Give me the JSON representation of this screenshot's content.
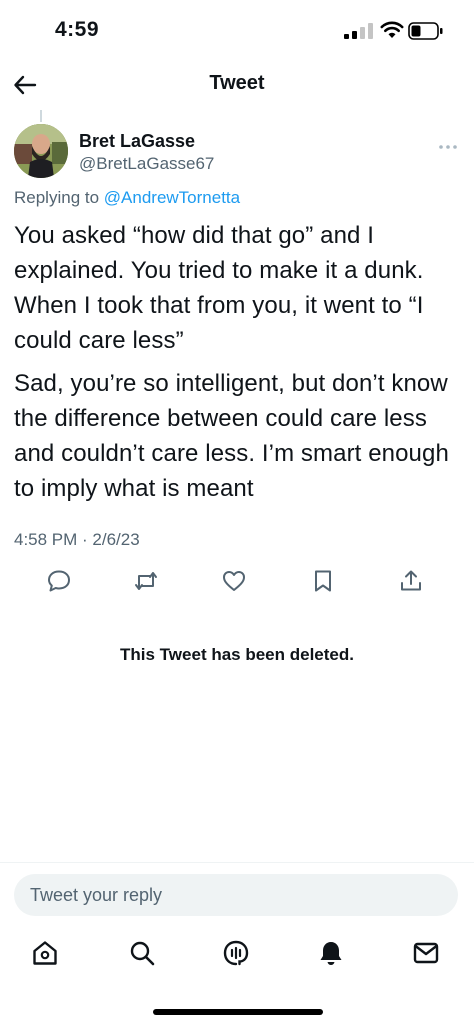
{
  "status_bar": {
    "time": "4:59"
  },
  "header": {
    "title": "Tweet",
    "back_icon": "arrow-left-icon"
  },
  "tweet": {
    "author_name": "Bret LaGasse",
    "author_handle": "@BretLaGasse67",
    "replying_prefix": "Replying to ",
    "replying_to": "@AndrewTornetta",
    "paragraphs": [
      "You asked “how did that go” and I explained. You tried to make it a dunk. When I took that from you, it went to “I could care less”",
      "Sad, you’re so intelligent, but don’t know the difference between could care less and couldn’t care less. I’m smart enough to imply what is meant"
    ],
    "timestamp": "4:58 PM · 2/6/23",
    "actions": [
      "reply-icon",
      "retweet-icon",
      "like-icon",
      "bookmark-icon",
      "share-icon"
    ]
  },
  "deleted_notice": "This Tweet has been deleted.",
  "reply_box": {
    "placeholder": "Tweet your reply"
  },
  "bottom_nav": [
    "home-icon",
    "search-icon",
    "spaces-icon",
    "notifications-icon",
    "messages-icon"
  ],
  "colors": {
    "text": "#0f1419",
    "secondary": "#536471",
    "link": "#1d9bf0",
    "reply_box_bg": "#eff3f4"
  }
}
